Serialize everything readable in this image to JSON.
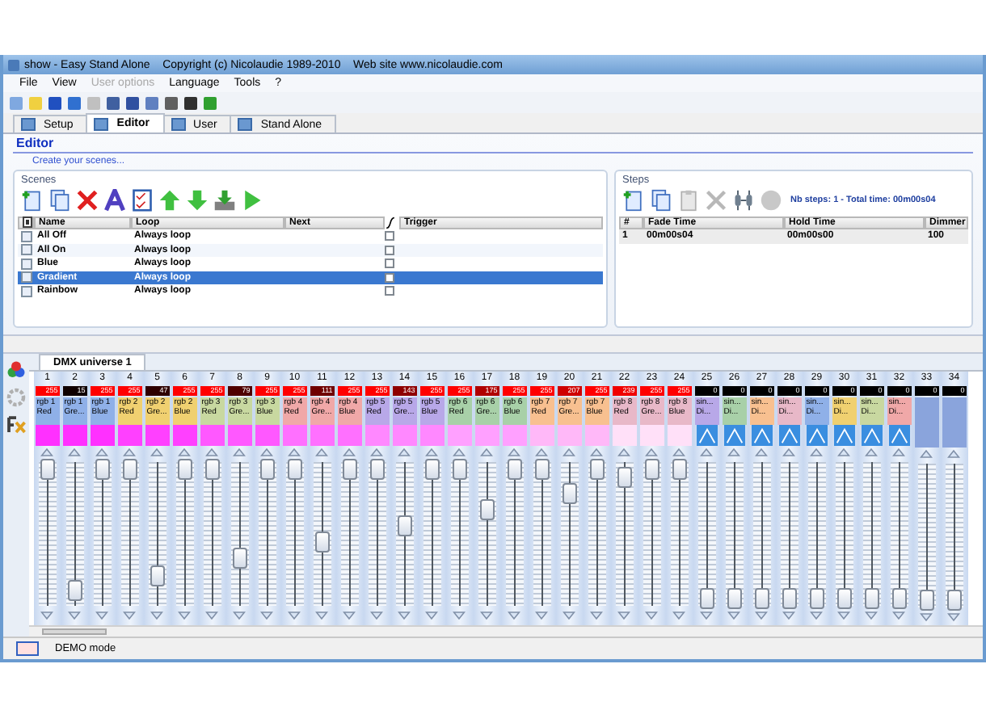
{
  "window": {
    "title": "show - Easy Stand Alone    Copyright (c) Nicolaudie 1989-2010    Web site www.nicolaudie.com"
  },
  "menu": [
    {
      "label": "File",
      "disabled": false
    },
    {
      "label": "View",
      "disabled": false
    },
    {
      "label": "User options",
      "disabled": true
    },
    {
      "label": "Language",
      "disabled": false
    },
    {
      "label": "Tools",
      "disabled": false
    },
    {
      "label": "?",
      "disabled": false
    }
  ],
  "tabs": [
    {
      "label": "Setup",
      "selected": false
    },
    {
      "label": "Editor",
      "selected": true
    },
    {
      "label": "User",
      "selected": false
    },
    {
      "label": "Stand Alone",
      "selected": false
    }
  ],
  "editor": {
    "title": "Editor",
    "subtitle": "Create your scenes..."
  },
  "scenes": {
    "title": "Scenes",
    "header_checked": true,
    "columns": [
      "Name",
      "Loop",
      "Next",
      "Trigger"
    ],
    "rows": [
      {
        "name": "All Off",
        "loop": "Always loop",
        "trigger": false,
        "selected": false
      },
      {
        "name": "All On",
        "loop": "Always loop",
        "trigger": false,
        "selected": false
      },
      {
        "name": "Blue",
        "loop": "Always loop",
        "trigger": false,
        "selected": false
      },
      {
        "name": "Gradient",
        "loop": "Always loop",
        "trigger": false,
        "selected": true
      },
      {
        "name": "Rainbow",
        "loop": "Always loop",
        "trigger": false,
        "selected": false
      }
    ]
  },
  "steps": {
    "title": "Steps",
    "summary": "Nb steps: 1 - Total time: 00m00s04",
    "columns": [
      "#",
      "Fade Time",
      "Hold Time",
      "Dimmer"
    ],
    "rows": [
      {
        "cells": [
          "1",
          "00m00s04",
          "00m00s00",
          "100"
        ]
      }
    ]
  },
  "dmx": {
    "tab": "DMX universe 1",
    "channels": [
      {
        "number": "1",
        "value": "255",
        "level": 1,
        "kind": "rgb",
        "label_1": "rgb 1",
        "label_2": "Red",
        "color": "#8fb0e8",
        "swatch": {
          "color": "#ff30ff"
        }
      },
      {
        "number": "2",
        "value": "15",
        "level": 0.06,
        "kind": "rgb",
        "label_1": "rgb 1",
        "label_2": "Gre...",
        "color": "#8fb0e8",
        "swatch": {
          "color": "#ff30ff"
        }
      },
      {
        "number": "3",
        "value": "255",
        "level": 1,
        "kind": "rgb",
        "label_1": "rgb 1",
        "label_2": "Blue",
        "color": "#8fb0e8",
        "swatch": {
          "color": "#ff30ff"
        }
      },
      {
        "number": "4",
        "value": "255",
        "level": 1,
        "kind": "rgb",
        "label_1": "rgb 2",
        "label_2": "Red",
        "color": "#f0d070",
        "swatch": {
          "color": "#ff40ff"
        }
      },
      {
        "number": "5",
        "value": "47",
        "level": 0.18,
        "kind": "rgb",
        "label_1": "rgb 2",
        "label_2": "Gre...",
        "color": "#f0d070",
        "swatch": {
          "color": "#ff40ff"
        }
      },
      {
        "number": "6",
        "value": "255",
        "level": 1,
        "kind": "rgb",
        "label_1": "rgb 2",
        "label_2": "Blue",
        "color": "#f0d070",
        "swatch": {
          "color": "#ff40ff"
        }
      },
      {
        "number": "7",
        "value": "255",
        "level": 1,
        "kind": "rgb",
        "label_1": "rgb 3",
        "label_2": "Red",
        "color": "#c8d8a0",
        "swatch": {
          "color": "#ff58ff"
        }
      },
      {
        "number": "8",
        "value": "79",
        "level": 0.31,
        "kind": "rgb",
        "label_1": "rgb 3",
        "label_2": "Gre...",
        "color": "#c8d8a0",
        "swatch": {
          "color": "#ff58ff"
        }
      },
      {
        "number": "9",
        "value": "255",
        "level": 1,
        "kind": "rgb",
        "label_1": "rgb 3",
        "label_2": "Blue",
        "color": "#c8d8a0",
        "swatch": {
          "color": "#ff58ff"
        }
      },
      {
        "number": "10",
        "value": "255",
        "level": 1,
        "kind": "rgb",
        "label_1": "rgb 4",
        "label_2": "Red",
        "color": "#f0a8a8",
        "swatch": {
          "color": "#ff70ff"
        }
      },
      {
        "number": "11",
        "value": "111",
        "level": 0.44,
        "kind": "rgb",
        "label_1": "rgb 4",
        "label_2": "Gre...",
        "color": "#f0a8a8",
        "swatch": {
          "color": "#ff70ff"
        }
      },
      {
        "number": "12",
        "value": "255",
        "level": 1,
        "kind": "rgb",
        "label_1": "rgb 4",
        "label_2": "Blue",
        "color": "#f0a8a8",
        "swatch": {
          "color": "#ff70ff"
        }
      },
      {
        "number": "13",
        "value": "255",
        "level": 1,
        "kind": "rgb",
        "label_1": "rgb 5",
        "label_2": "Red",
        "color": "#b8a8e8",
        "swatch": {
          "color": "#ff88ff"
        }
      },
      {
        "number": "14",
        "value": "143",
        "level": 0.56,
        "kind": "rgb",
        "label_1": "rgb 5",
        "label_2": "Gre...",
        "color": "#b8a8e8",
        "swatch": {
          "color": "#ff88ff"
        }
      },
      {
        "number": "15",
        "value": "255",
        "level": 1,
        "kind": "rgb",
        "label_1": "rgb 5",
        "label_2": "Blue",
        "color": "#b8a8e8",
        "swatch": {
          "color": "#ff88ff"
        }
      },
      {
        "number": "16",
        "value": "255",
        "level": 1,
        "kind": "rgb",
        "label_1": "rgb 6",
        "label_2": "Red",
        "color": "#a8d0a8",
        "swatch": {
          "color": "#ffa0ff"
        }
      },
      {
        "number": "17",
        "value": "175",
        "level": 0.69,
        "kind": "rgb",
        "label_1": "rgb 6",
        "label_2": "Gre...",
        "color": "#a8d0a8",
        "swatch": {
          "color": "#ffa0ff"
        }
      },
      {
        "number": "18",
        "value": "255",
        "level": 1,
        "kind": "rgb",
        "label_1": "rgb 6",
        "label_2": "Blue",
        "color": "#a8d0a8",
        "swatch": {
          "color": "#ffa0ff"
        }
      },
      {
        "number": "19",
        "value": "255",
        "level": 1,
        "kind": "rgb",
        "label_1": "rgb 7",
        "label_2": "Red",
        "color": "#f8c090",
        "swatch": {
          "color": "#ffb8f8"
        }
      },
      {
        "number": "20",
        "value": "207",
        "level": 0.81,
        "kind": "rgb",
        "label_1": "rgb 7",
        "label_2": "Gre...",
        "color": "#f8c090",
        "swatch": {
          "color": "#ffb8f8"
        }
      },
      {
        "number": "21",
        "value": "255",
        "level": 1,
        "kind": "rgb",
        "label_1": "rgb 7",
        "label_2": "Blue",
        "color": "#f8c090",
        "swatch": {
          "color": "#ffb8f8"
        }
      },
      {
        "number": "22",
        "value": "239",
        "level": 0.94,
        "kind": "rgb",
        "label_1": "rgb 8",
        "label_2": "Red",
        "color": "#e8b8c8",
        "swatch": {
          "color": "#ffe0f8"
        }
      },
      {
        "number": "23",
        "value": "255",
        "level": 1,
        "kind": "rgb",
        "label_1": "rgb 8",
        "label_2": "Gre...",
        "color": "#e8b8c8",
        "swatch": {
          "color": "#ffe0f8"
        }
      },
      {
        "number": "24",
        "value": "255",
        "level": 1,
        "kind": "rgb",
        "label_1": "rgb 8",
        "label_2": "Blue",
        "color": "#e8b8c8",
        "swatch": {
          "color": "#ffe0f8"
        }
      },
      {
        "number": "25",
        "value": "0",
        "level": 0,
        "kind": "sine",
        "label_1": "sin...",
        "label_2": "Di...",
        "color": "#b8a8e8"
      },
      {
        "number": "26",
        "value": "0",
        "level": 0,
        "kind": "sine",
        "label_1": "sin...",
        "label_2": "Di...",
        "color": "#a8d0a8"
      },
      {
        "number": "27",
        "value": "0",
        "level": 0,
        "kind": "sine",
        "label_1": "sin...",
        "label_2": "Di...",
        "color": "#f8c090"
      },
      {
        "number": "28",
        "value": "0",
        "level": 0,
        "kind": "sine",
        "label_1": "sin...",
        "label_2": "Di...",
        "color": "#e8b8c8"
      },
      {
        "number": "29",
        "value": "0",
        "level": 0,
        "kind": "sine",
        "label_1": "sin...",
        "label_2": "Di...",
        "color": "#8fb0e8"
      },
      {
        "number": "30",
        "value": "0",
        "level": 0,
        "kind": "sine",
        "label_1": "sin...",
        "label_2": "Di...",
        "color": "#f0d070"
      },
      {
        "number": "31",
        "value": "0",
        "level": 0,
        "kind": "sine",
        "label_1": "sin...",
        "label_2": "Di...",
        "color": "#c8d8a0"
      },
      {
        "number": "32",
        "value": "0",
        "level": 0,
        "kind": "sine",
        "label_1": "sin...",
        "label_2": "Di...",
        "color": "#f0a8a8"
      },
      {
        "number": "33",
        "value": "0",
        "level": 0,
        "kind": "empty"
      },
      {
        "number": "34",
        "value": "0",
        "level": 0,
        "kind": "empty"
      }
    ]
  },
  "status_bar": {
    "text": "DEMO mode"
  }
}
